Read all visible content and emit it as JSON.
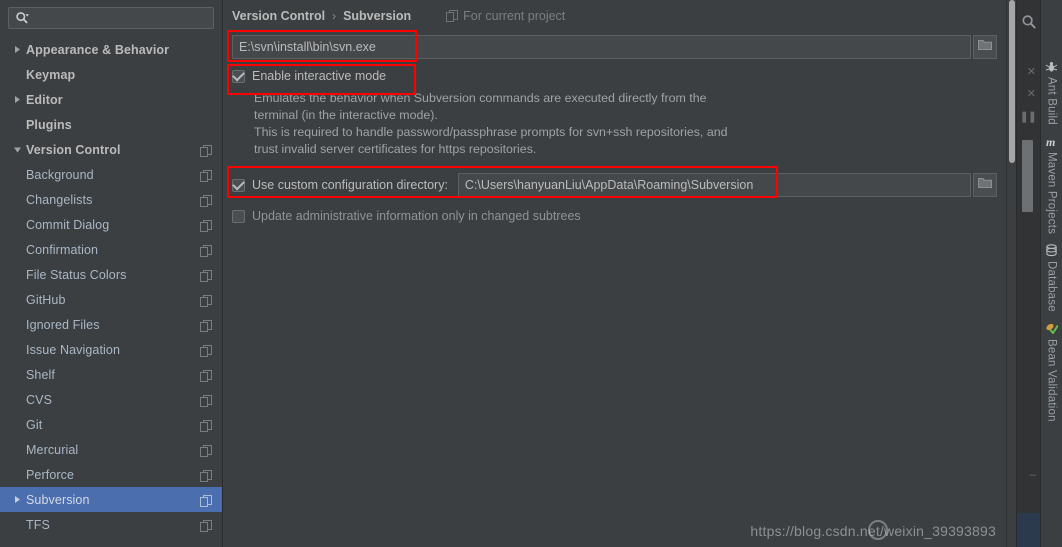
{
  "search": {
    "value": "",
    "placeholder": "",
    "icon": "search-icon"
  },
  "sidebar": {
    "items": [
      {
        "label": "Appearance & Behavior",
        "depth": 0,
        "arrow": "right",
        "bold": true,
        "copy": false,
        "selected": false
      },
      {
        "label": "Keymap",
        "depth": 0,
        "arrow": "none",
        "bold": true,
        "copy": false,
        "selected": false
      },
      {
        "label": "Editor",
        "depth": 0,
        "arrow": "right",
        "bold": true,
        "copy": false,
        "selected": false
      },
      {
        "label": "Plugins",
        "depth": 0,
        "arrow": "none",
        "bold": true,
        "copy": false,
        "selected": false
      },
      {
        "label": "Version Control",
        "depth": 0,
        "arrow": "down",
        "bold": true,
        "copy": true,
        "selected": false
      },
      {
        "label": "Background",
        "depth": 1,
        "arrow": "none",
        "bold": false,
        "copy": true,
        "selected": false
      },
      {
        "label": "Changelists",
        "depth": 1,
        "arrow": "none",
        "bold": false,
        "copy": true,
        "selected": false
      },
      {
        "label": "Commit Dialog",
        "depth": 1,
        "arrow": "none",
        "bold": false,
        "copy": true,
        "selected": false
      },
      {
        "label": "Confirmation",
        "depth": 1,
        "arrow": "none",
        "bold": false,
        "copy": true,
        "selected": false
      },
      {
        "label": "File Status Colors",
        "depth": 1,
        "arrow": "none",
        "bold": false,
        "copy": true,
        "selected": false
      },
      {
        "label": "GitHub",
        "depth": 1,
        "arrow": "none",
        "bold": false,
        "copy": true,
        "selected": false
      },
      {
        "label": "Ignored Files",
        "depth": 1,
        "arrow": "none",
        "bold": false,
        "copy": true,
        "selected": false
      },
      {
        "label": "Issue Navigation",
        "depth": 1,
        "arrow": "none",
        "bold": false,
        "copy": true,
        "selected": false
      },
      {
        "label": "Shelf",
        "depth": 1,
        "arrow": "none",
        "bold": false,
        "copy": true,
        "selected": false
      },
      {
        "label": "CVS",
        "depth": 1,
        "arrow": "none",
        "bold": false,
        "copy": true,
        "selected": false
      },
      {
        "label": "Git",
        "depth": 1,
        "arrow": "none",
        "bold": false,
        "copy": true,
        "selected": false
      },
      {
        "label": "Mercurial",
        "depth": 1,
        "arrow": "none",
        "bold": false,
        "copy": true,
        "selected": false
      },
      {
        "label": "Perforce",
        "depth": 1,
        "arrow": "none",
        "bold": false,
        "copy": true,
        "selected": false
      },
      {
        "label": "Subversion",
        "depth": 1,
        "arrow": "right",
        "bold": false,
        "copy": true,
        "selected": true
      },
      {
        "label": "TFS",
        "depth": 1,
        "arrow": "none",
        "bold": false,
        "copy": true,
        "selected": false
      }
    ]
  },
  "breadcrumb": {
    "parent": "Version Control",
    "separator": "›",
    "current": "Subversion",
    "scope_label": "For current project",
    "scope_icon": "copy-icon"
  },
  "main": {
    "svn_path": {
      "value": "E:\\svn\\install\\bin\\svn.exe",
      "placeholder": "",
      "browse_icon": "folder-icon"
    },
    "interactive_mode": {
      "label": "Enable interactive mode",
      "checked": true
    },
    "description_lines": [
      "Emulates the behavior when Subversion commands are executed directly from the",
      "terminal (in the interactive mode).",
      "This is required to handle password/passphrase prompts for svn+ssh repositories, and",
      "trust invalid server certificates for https repositories."
    ],
    "custom_config": {
      "label": "Use custom configuration directory:",
      "checked": true,
      "value": "C:\\Users\\hanyuanLiu\\AppData\\Roaming\\Subversion",
      "browse_icon": "folder-icon"
    },
    "update_admin": {
      "label": "Update administrative information only in changed subtrees",
      "checked": false
    }
  },
  "right_tools": {
    "tabs": [
      {
        "label": "Ant Build",
        "icon": "ant-icon"
      },
      {
        "label": "Maven Projects",
        "icon": "maven-icon"
      },
      {
        "label": "Database",
        "icon": "database-icon"
      },
      {
        "label": "Bean Validation",
        "icon": "bean-validation-icon"
      }
    ]
  },
  "watermark": {
    "text": "https://blog.csdn.net/weixin_39393893"
  },
  "colors": {
    "background": "#3c3f41",
    "panel": "#313335",
    "selection": "#4b6eaf",
    "text": "#bbbbbb",
    "text_muted": "#9fa3a6",
    "field": "#45484a",
    "border": "#5e6060",
    "annotation": "#ff0000"
  }
}
